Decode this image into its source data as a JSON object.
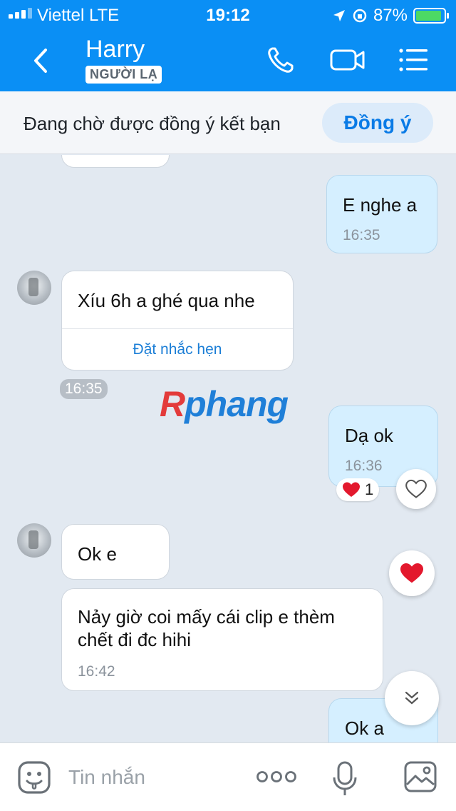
{
  "status_bar": {
    "carrier": "Viettel  LTE",
    "time": "19:12",
    "battery": "87%",
    "battery_level": 0.87
  },
  "header": {
    "title": "Harry",
    "tag": "NGƯỜI LẠ",
    "icons": [
      "back-icon",
      "phone-icon",
      "video-call-icon",
      "menu-icon"
    ]
  },
  "friend_bar": {
    "text": "Đang chờ được đồng ý kết bạn",
    "button": "Đồng ý"
  },
  "messages": [
    {
      "dir": "out",
      "text": "E nghe a",
      "time": "16:35"
    },
    {
      "dir": "in",
      "text": "Xíu 6h a ghé qua nhe",
      "action": "Đặt nhắc hẹn",
      "time": "16:35"
    },
    {
      "dir": "out",
      "text": "Dạ ok",
      "time": "16:36",
      "reaction_count": "1"
    },
    {
      "dir": "in",
      "text": "Ok e"
    },
    {
      "dir": "in",
      "text": "Nảy giờ coi mấy cái clip e thèm\nchết đi đc hihi",
      "line1": "Nảy giờ coi mấy cái clip e thèm",
      "line2": "chết đi đc hihi",
      "time": "16:42"
    },
    {
      "dir": "out",
      "text": "Ok a"
    }
  ],
  "watermark": {
    "r": "R",
    "rest": "phang"
  },
  "composer": {
    "placeholder": "Tin nhắn"
  },
  "colors": {
    "header": "#0a8ff5",
    "outgoing": "#d5efff",
    "incoming": "#ffffff",
    "heart": "#e3182d",
    "link": "#1b7ed6"
  }
}
